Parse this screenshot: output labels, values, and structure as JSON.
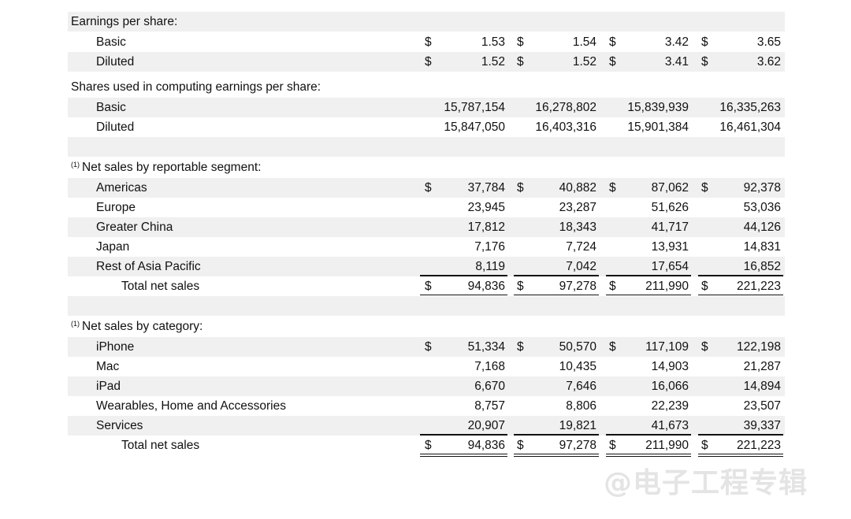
{
  "eps": {
    "heading": "Earnings per share:",
    "rows": [
      {
        "label": "Basic",
        "values": [
          "1.53",
          "1.54",
          "3.42",
          "3.65"
        ]
      },
      {
        "label": "Diluted",
        "values": [
          "1.52",
          "1.52",
          "3.41",
          "3.62"
        ]
      }
    ]
  },
  "shares": {
    "heading": "Shares used in computing earnings per share:",
    "rows": [
      {
        "label": "Basic",
        "values": [
          "15,787,154",
          "16,278,802",
          "15,839,939",
          "16,335,263"
        ]
      },
      {
        "label": "Diluted",
        "values": [
          "15,847,050",
          "16,403,316",
          "15,901,384",
          "16,461,304"
        ]
      }
    ]
  },
  "segment": {
    "footnote": "(1)",
    "heading": "Net sales by reportable segment:",
    "rows": [
      {
        "label": "Americas",
        "values": [
          "37,784",
          "40,882",
          "87,062",
          "92,378"
        ]
      },
      {
        "label": "Europe",
        "values": [
          "23,945",
          "23,287",
          "51,626",
          "53,036"
        ]
      },
      {
        "label": "Greater China",
        "values": [
          "17,812",
          "18,343",
          "41,717",
          "44,126"
        ]
      },
      {
        "label": "Japan",
        "values": [
          "7,176",
          "7,724",
          "13,931",
          "14,831"
        ]
      },
      {
        "label": "Rest of Asia Pacific",
        "values": [
          "8,119",
          "7,042",
          "17,654",
          "16,852"
        ]
      }
    ],
    "total": {
      "label": "Total net sales",
      "values": [
        "94,836",
        "97,278",
        "211,990",
        "221,223"
      ]
    }
  },
  "category": {
    "footnote": "(1)",
    "heading": "Net sales by category:",
    "rows": [
      {
        "label": "iPhone",
        "values": [
          "51,334",
          "50,570",
          "117,109",
          "122,198"
        ]
      },
      {
        "label": "Mac",
        "values": [
          "7,168",
          "10,435",
          "14,903",
          "21,287"
        ]
      },
      {
        "label": "iPad",
        "values": [
          "6,670",
          "7,646",
          "16,066",
          "14,894"
        ]
      },
      {
        "label": "Wearables, Home and Accessories",
        "values": [
          "8,757",
          "8,806",
          "22,239",
          "23,507"
        ]
      },
      {
        "label": "Services",
        "values": [
          "20,907",
          "19,821",
          "41,673",
          "39,337"
        ]
      }
    ],
    "total": {
      "label": "Total net sales",
      "values": [
        "94,836",
        "97,278",
        "211,990",
        "221,223"
      ]
    }
  },
  "currency_symbol": "$",
  "watermark": "@电子工程专辑",
  "colors": {
    "row_shade": "#f0f0f0",
    "text": "#111111"
  }
}
